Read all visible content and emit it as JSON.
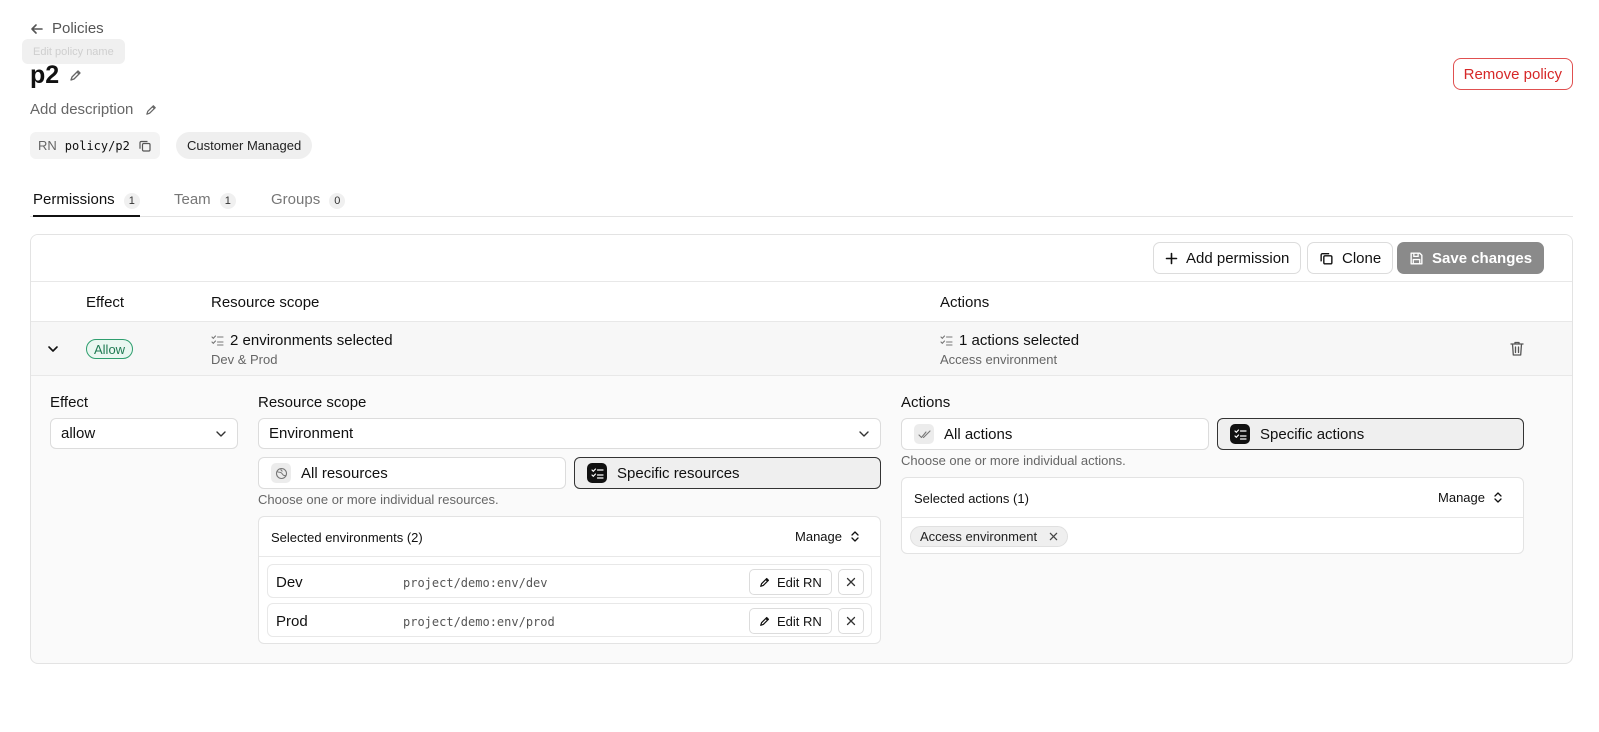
{
  "header": {
    "back_label": "Policies",
    "tooltip": "Edit policy name",
    "title": "p2",
    "description_placeholder": "Add description",
    "rn_label": "RN",
    "rn_value": "policy/p2",
    "managed_badge": "Customer Managed",
    "remove_label": "Remove policy"
  },
  "tabs": [
    {
      "label": "Permissions",
      "count": "1",
      "active": true
    },
    {
      "label": "Team",
      "count": "1",
      "active": false
    },
    {
      "label": "Groups",
      "count": "0",
      "active": false
    }
  ],
  "toolbar": {
    "add_label": "Add permission",
    "clone_label": "Clone",
    "save_label": "Save changes"
  },
  "table": {
    "headers": {
      "effect": "Effect",
      "scope": "Resource scope",
      "actions": "Actions"
    },
    "row": {
      "effect": "Allow",
      "scope_title": "2 environments selected",
      "scope_sub": "Dev & Prod",
      "actions_title": "1 actions selected",
      "actions_sub": "Access environment"
    }
  },
  "editor": {
    "effect_label": "Effect",
    "effect_value": "allow",
    "scope_label": "Resource scope",
    "scope_value": "Environment",
    "all_resources": "All resources",
    "specific_resources": "Specific resources",
    "resources_hint": "Choose one or more individual resources.",
    "env_box_title": "Selected environments (2)",
    "manage_label": "Manage",
    "environments": [
      {
        "name": "Dev",
        "rn": "project/demo:env/dev"
      },
      {
        "name": "Prod",
        "rn": "project/demo:env/prod"
      }
    ],
    "edit_rn_label": "Edit RN",
    "actions_label": "Actions",
    "all_actions": "All actions",
    "specific_actions": "Specific actions",
    "actions_hint": "Choose one or more individual actions.",
    "actions_box_title": "Selected actions (1)",
    "selected_action": "Access environment"
  },
  "colors": {
    "danger": "#d62828",
    "allow_green": "#2e9e6e",
    "save_disabled": "#8a8a8a"
  }
}
